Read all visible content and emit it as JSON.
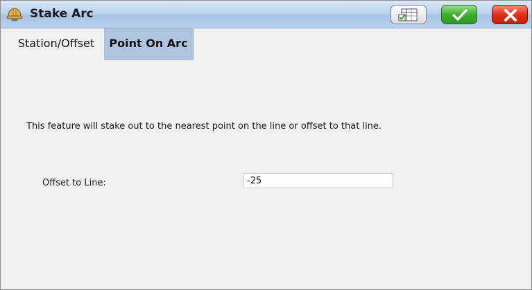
{
  "window": {
    "title": "Stake Arc",
    "title_icon": "hardhat-icon",
    "buttons": [
      {
        "name": "settings-grid-button",
        "icon": "table-checkbox-icon"
      },
      {
        "name": "accept-button",
        "icon": "checkmark-icon",
        "color": "#3fae2c"
      },
      {
        "name": "close-button",
        "icon": "x-icon",
        "color": "#e0301a"
      }
    ]
  },
  "tabs": [
    {
      "label": "Station/Offset",
      "active": false
    },
    {
      "label": "Point On Arc",
      "active": true
    }
  ],
  "content": {
    "description": "This feature will stake out to the nearest point on the line or offset to that line.",
    "offset_label": "Offset to Line:",
    "offset_value": "-25"
  },
  "colors": {
    "active_tab": "#aec4df",
    "background": "#f0f0f0"
  }
}
